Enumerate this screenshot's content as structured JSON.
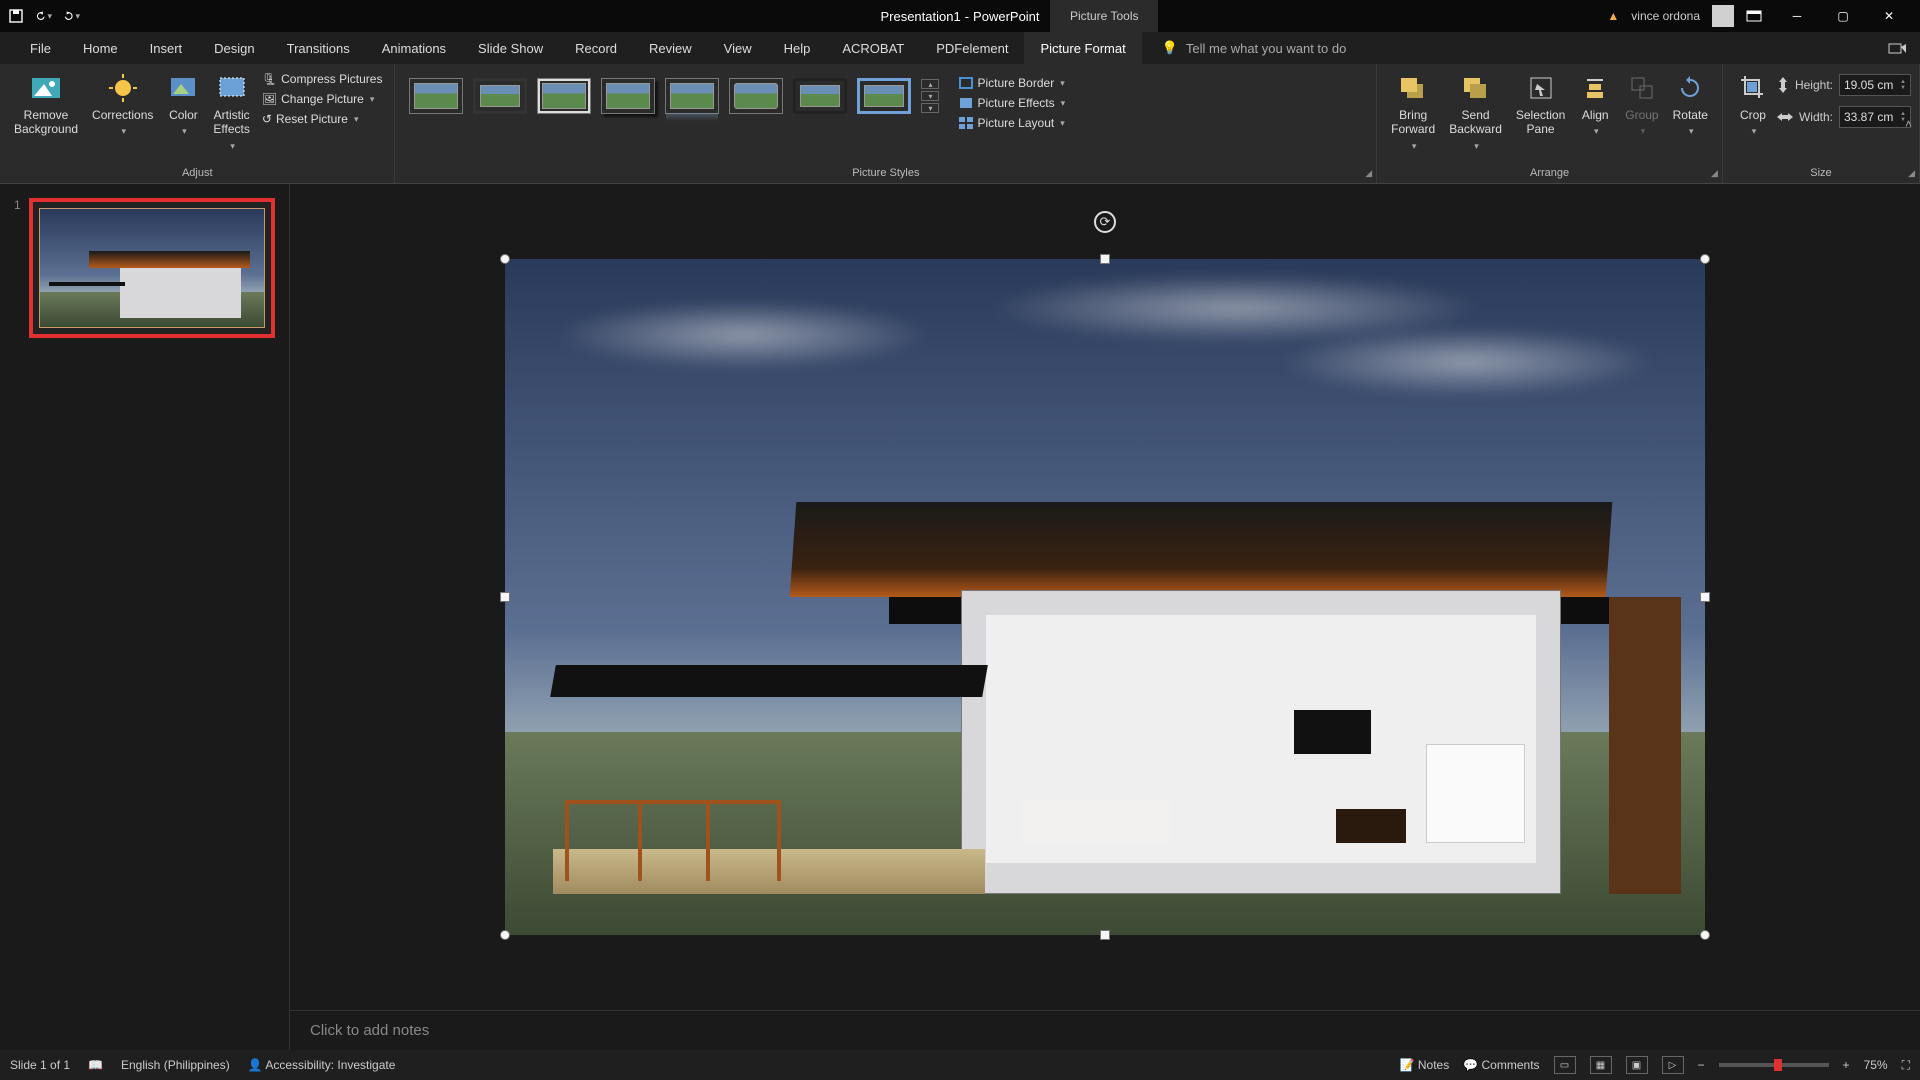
{
  "title": {
    "doc": "Presentation1",
    "app": "PowerPoint",
    "sep": "  -  "
  },
  "contextual_tab": "Picture Tools",
  "user": {
    "name": "vince ordona"
  },
  "tabs": [
    "File",
    "Home",
    "Insert",
    "Design",
    "Transitions",
    "Animations",
    "Slide Show",
    "Record",
    "Review",
    "View",
    "Help",
    "ACROBAT",
    "PDFelement",
    "Picture Format"
  ],
  "active_tab": "Picture Format",
  "tell_me": "Tell me what you want to do",
  "ribbon": {
    "adjust": {
      "label": "Adjust",
      "remove_bg": "Remove\nBackground",
      "corrections": "Corrections",
      "color": "Color",
      "effects": "Artistic\nEffects",
      "compress": "Compress Pictures",
      "change": "Change Picture",
      "reset": "Reset Picture"
    },
    "styles": {
      "label": "Picture Styles",
      "border": "Picture Border",
      "effects": "Picture Effects",
      "layout": "Picture Layout"
    },
    "arrange": {
      "label": "Arrange",
      "forward": "Bring\nForward",
      "backward": "Send\nBackward",
      "selection": "Selection\nPane",
      "align": "Align",
      "group": "Group",
      "rotate": "Rotate"
    },
    "size": {
      "label": "Size",
      "crop": "Crop",
      "height_label": "Height:",
      "height_value": "19.05 cm",
      "width_label": "Width:",
      "width_value": "33.87 cm"
    }
  },
  "slide_number": "1",
  "notes_placeholder": "Click to add notes",
  "status": {
    "slide_info": "Slide 1 of 1",
    "language": "English (Philippines)",
    "accessibility": "Accessibility: Investigate",
    "notes": "Notes",
    "comments": "Comments",
    "zoom": "75%"
  }
}
